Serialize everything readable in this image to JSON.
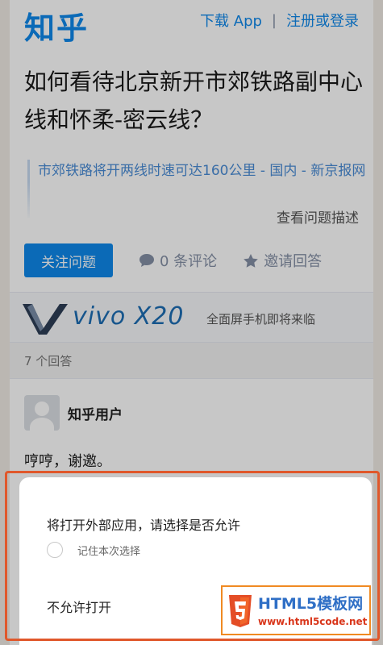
{
  "header": {
    "logo": "知乎",
    "download_label": "下载 App",
    "separator": "|",
    "login_label": "注册或登录"
  },
  "question": {
    "title": "如何看待北京新开市郊铁路副中心线和怀柔-密云线？",
    "excerpt": "市郊铁路将开两线时速可达160公里 - 国内 - 新京报网",
    "view_description": "查看问题描述"
  },
  "actions": {
    "follow": "关注问题",
    "comments": "0 条评论",
    "invite": "邀请回答"
  },
  "ad": {
    "brand": "vivo X20",
    "tagline": "全面屏手机即将来临"
  },
  "answers": {
    "count_label": "7 个回答",
    "first": {
      "author": "知乎用户",
      "text": "哼哼，谢邀。"
    }
  },
  "dialog": {
    "title": "将打开外部应用，请选择是否允许",
    "remember_label": "记住本次选择",
    "deny_label": "不允许打开"
  },
  "watermark": {
    "top": "HTML5模板网",
    "bottom": "www.html5code.net"
  },
  "colors": {
    "brand_blue": "#0f88eb",
    "highlight": "#e0582b"
  }
}
